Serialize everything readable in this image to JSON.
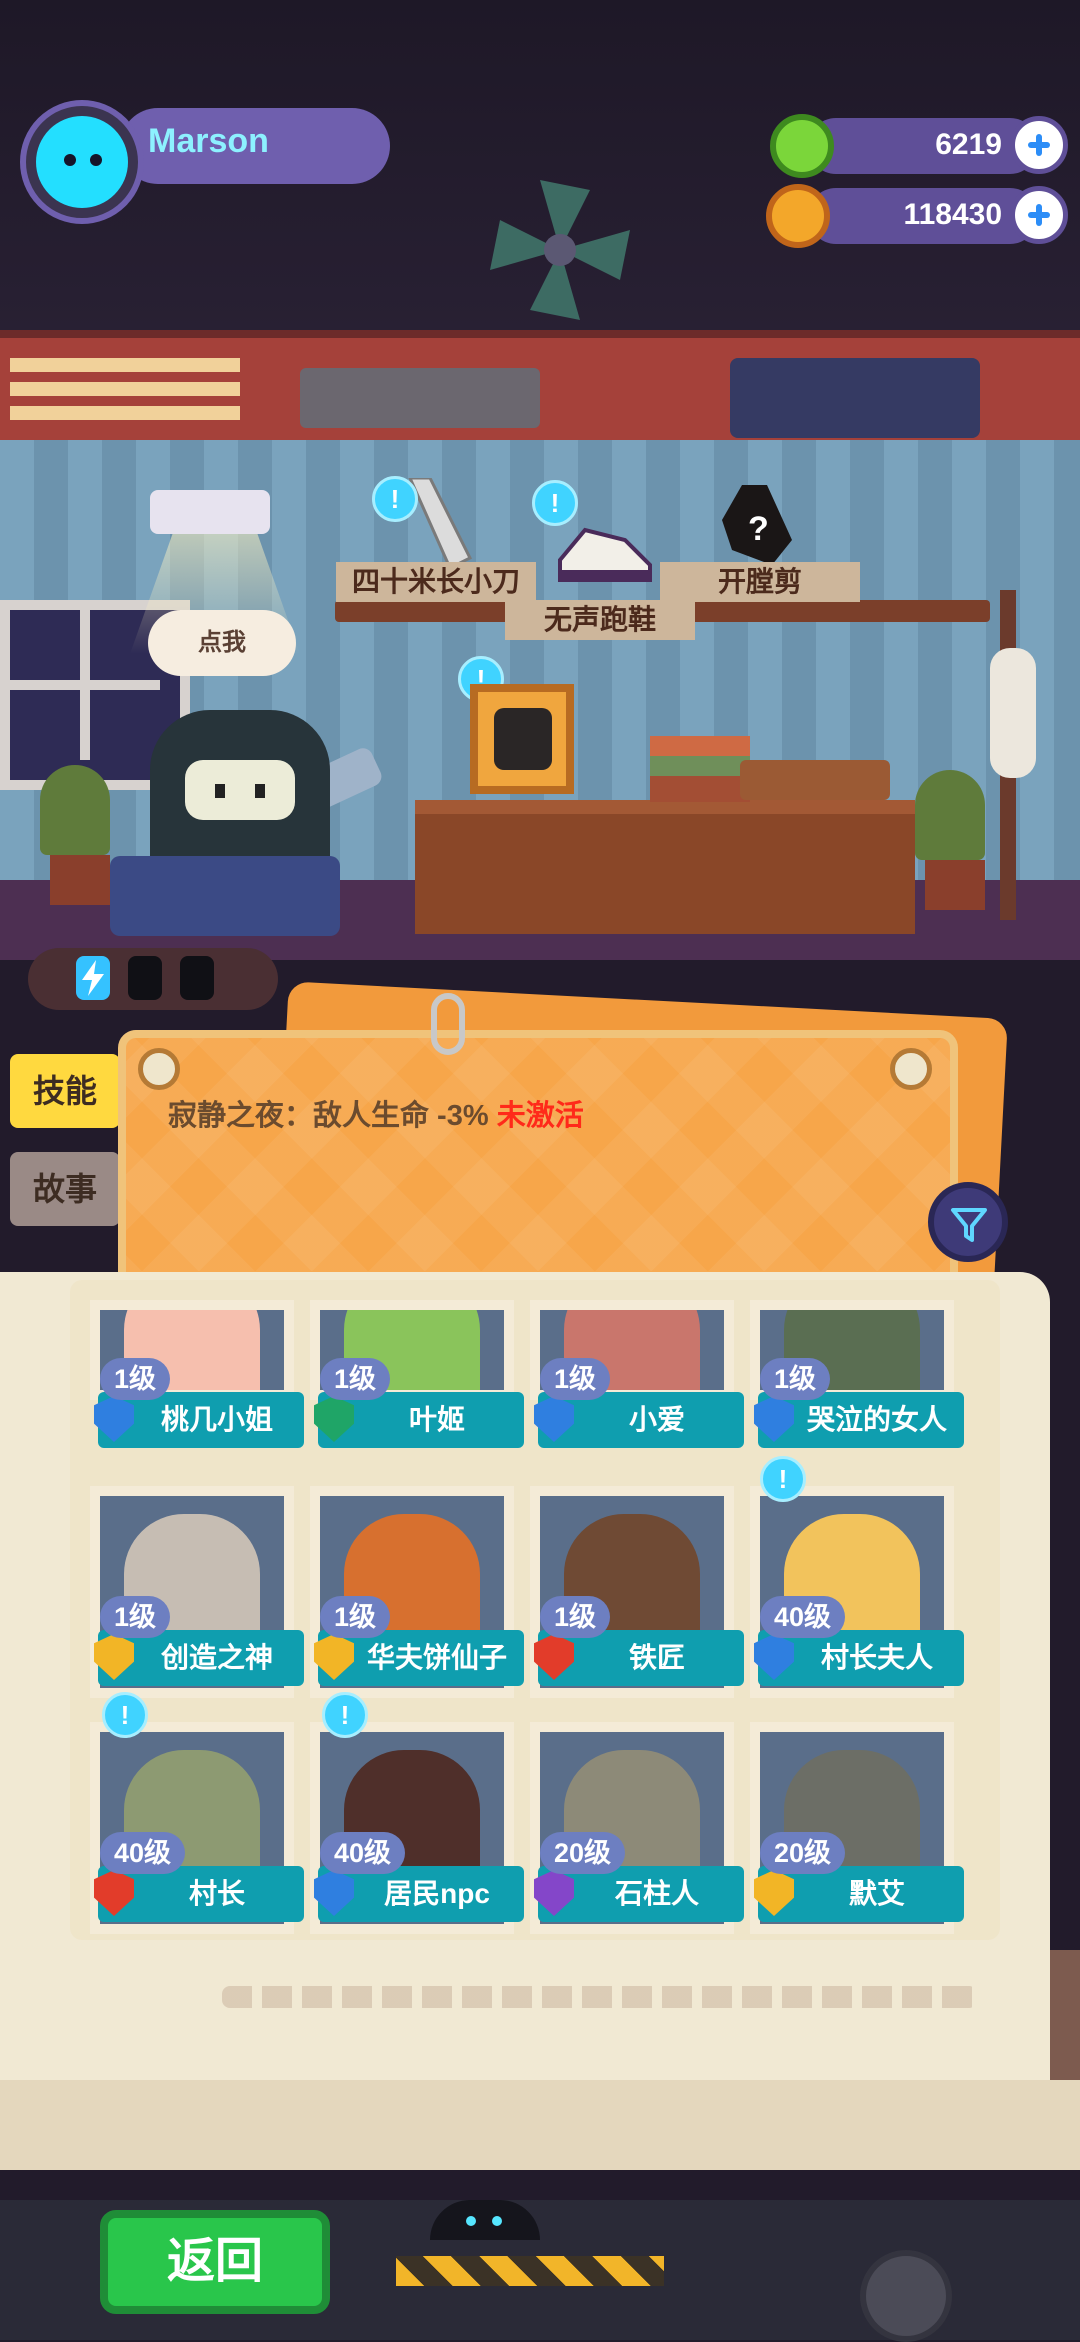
{
  "player": {
    "name": "Marson"
  },
  "currencies": [
    {
      "icon": "green-gem-icon",
      "value": "6219"
    },
    {
      "icon": "gold-planet-coin-icon",
      "value": "118430"
    }
  ],
  "scene": {
    "talk_bubble": "点我",
    "items": [
      {
        "label": "四十米长小刀"
      },
      {
        "label": "无声跑鞋"
      },
      {
        "label": "开膛剪"
      }
    ]
  },
  "side_tabs": [
    {
      "label": "技能",
      "active": true
    },
    {
      "label": "故事",
      "active": false
    }
  ],
  "skill": {
    "text": "寂静之夜：敌人生命 -3%",
    "status": "未激活",
    "status_color": "#ff2a1a"
  },
  "characters": [
    {
      "name": "桃几小姐",
      "level": "1级",
      "badge": "blue",
      "alert": false
    },
    {
      "name": "叶姬",
      "level": "1级",
      "badge": "green",
      "alert": false
    },
    {
      "name": "小爱",
      "level": "1级",
      "badge": "blue",
      "alert": false
    },
    {
      "name": "哭泣的女人",
      "level": "1级",
      "badge": "blue",
      "alert": false
    },
    {
      "name": "创造之神",
      "level": "1级",
      "badge": "gold",
      "alert": false
    },
    {
      "name": "华夫饼仙子",
      "level": "1级",
      "badge": "gold",
      "alert": false
    },
    {
      "name": "铁匠",
      "level": "1级",
      "badge": "red",
      "alert": false
    },
    {
      "name": "村长夫人",
      "level": "40级",
      "badge": "blue",
      "alert": true
    },
    {
      "name": "村长",
      "level": "40级",
      "badge": "red",
      "alert": true
    },
    {
      "name": "居民npc",
      "level": "40级",
      "badge": "blue",
      "alert": true
    },
    {
      "name": "石柱人",
      "level": "20级",
      "badge": "purple",
      "alert": false
    },
    {
      "name": "默艾",
      "level": "20级",
      "badge": "gold",
      "alert": false
    }
  ],
  "back_button": {
    "label": "返回"
  },
  "colors": {
    "accent_teal": "#0f9eaf",
    "board_orange": "#f7a64a",
    "back_green": "#29c64b"
  }
}
